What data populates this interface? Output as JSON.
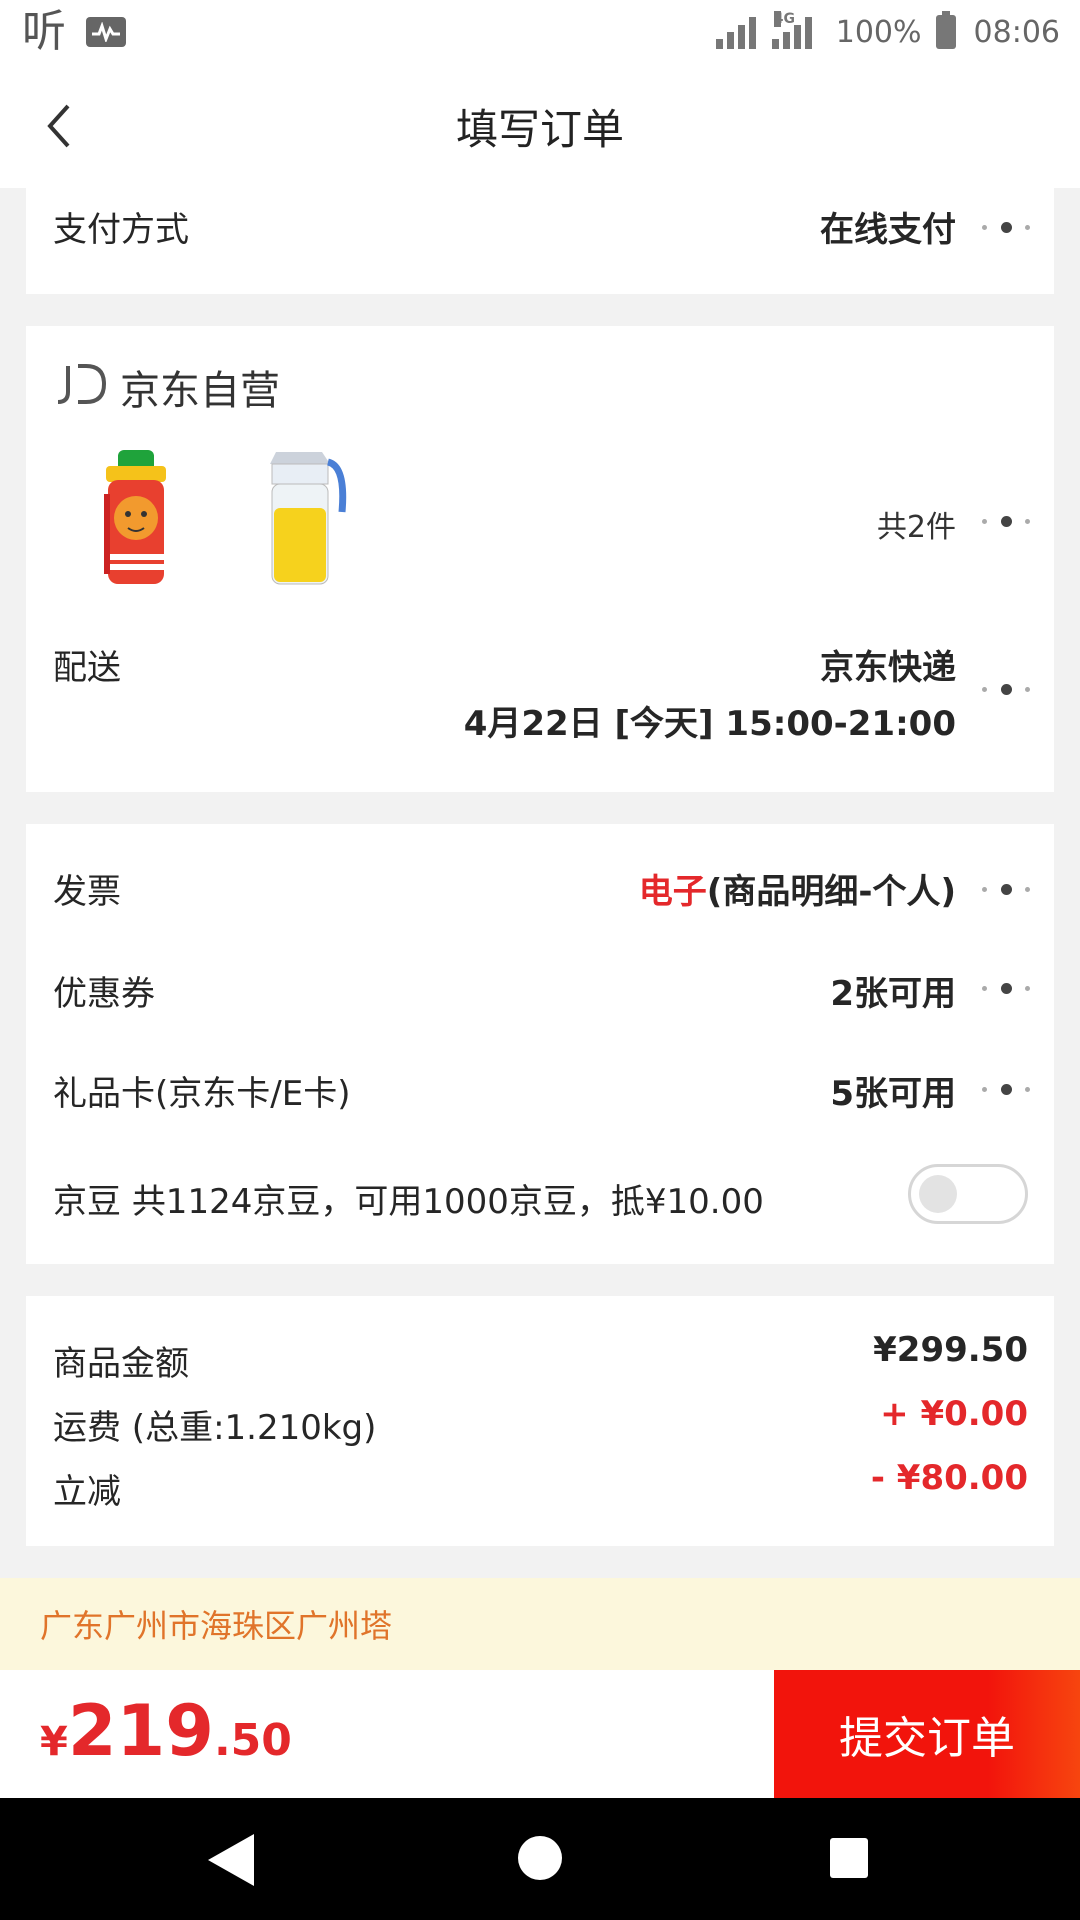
{
  "status_bar": {
    "left_text": "听",
    "network_type": "4G",
    "battery": "100%",
    "time": "08:06",
    "icons": [
      "listen-app-icon",
      "activity-icon",
      "signal-icon",
      "signal-4g-icon",
      "battery-icon"
    ]
  },
  "header": {
    "title": "填写订单",
    "back_icon": "chevron-left-icon"
  },
  "payment": {
    "label": "支付方式",
    "value": "在线支付"
  },
  "shop": {
    "logo_text": "JD",
    "name": "京东自营",
    "products": [
      {
        "name": "kids-water-bottle-icon"
      },
      {
        "name": "oil-dispenser-icon"
      }
    ],
    "count_text": "共2件",
    "delivery_label": "配送",
    "delivery_method": "京东快递",
    "delivery_time": "4月22日 [今天] 15:00-21:00"
  },
  "options": {
    "invoice_label": "发票",
    "invoice_type": "电子",
    "invoice_detail": "(商品明细-个人)",
    "coupon_label": "优惠券",
    "coupon_value": "2张可用",
    "giftcard_label": "礼品卡(京东卡/E卡)",
    "giftcard_value": "5张可用",
    "jingdou_label": "京豆",
    "jingdou_text": "共1124京豆，可用1000京豆，抵¥10.00",
    "jingdou_enabled": false
  },
  "summary": {
    "goods_label": "商品金额",
    "goods_value": "¥299.50",
    "shipping_label": "运费 (总重:1.210kg)",
    "shipping_value": "+ ¥0.00",
    "discount_label": "立减",
    "discount_value": "- ¥80.00"
  },
  "address": {
    "text": "广东广州市海珠区广州塔"
  },
  "footer": {
    "currency": "¥",
    "total_int": "219",
    "total_dec": ".50",
    "submit_label": "提交订单"
  },
  "colors": {
    "accent_red": "#e4282b",
    "submit_red": "#f2140c",
    "address_orange": "#e0742a",
    "address_bg": "#fcf7dc"
  }
}
